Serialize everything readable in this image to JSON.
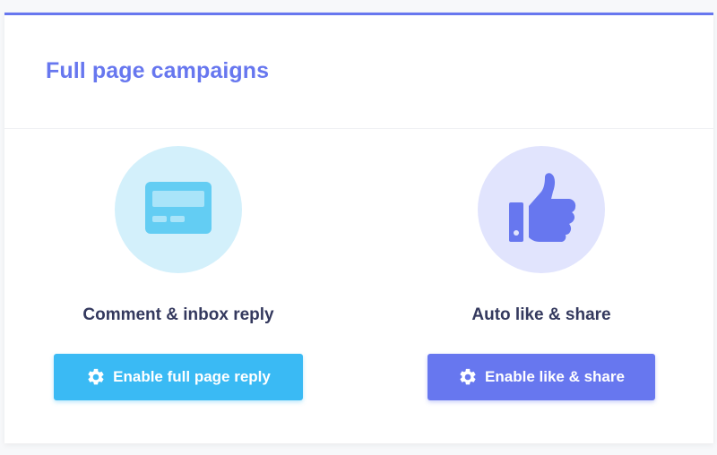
{
  "header": {
    "title": "Full page campaigns"
  },
  "features": [
    {
      "title": "Comment & inbox reply",
      "icon": "card-icon",
      "button_label": "Enable full page reply",
      "button_icon": "gear-icon",
      "accent": "#3abaf4",
      "circle_bg": "#d3f0fb"
    },
    {
      "title": "Auto like & share",
      "icon": "thumbs-up-icon",
      "button_label": "Enable like & share",
      "button_icon": "gear-icon",
      "accent": "#6777ef",
      "circle_bg": "#e1e4fd"
    }
  ],
  "colors": {
    "primary": "#6777ef",
    "info": "#3abaf4",
    "heading": "#34395e"
  }
}
